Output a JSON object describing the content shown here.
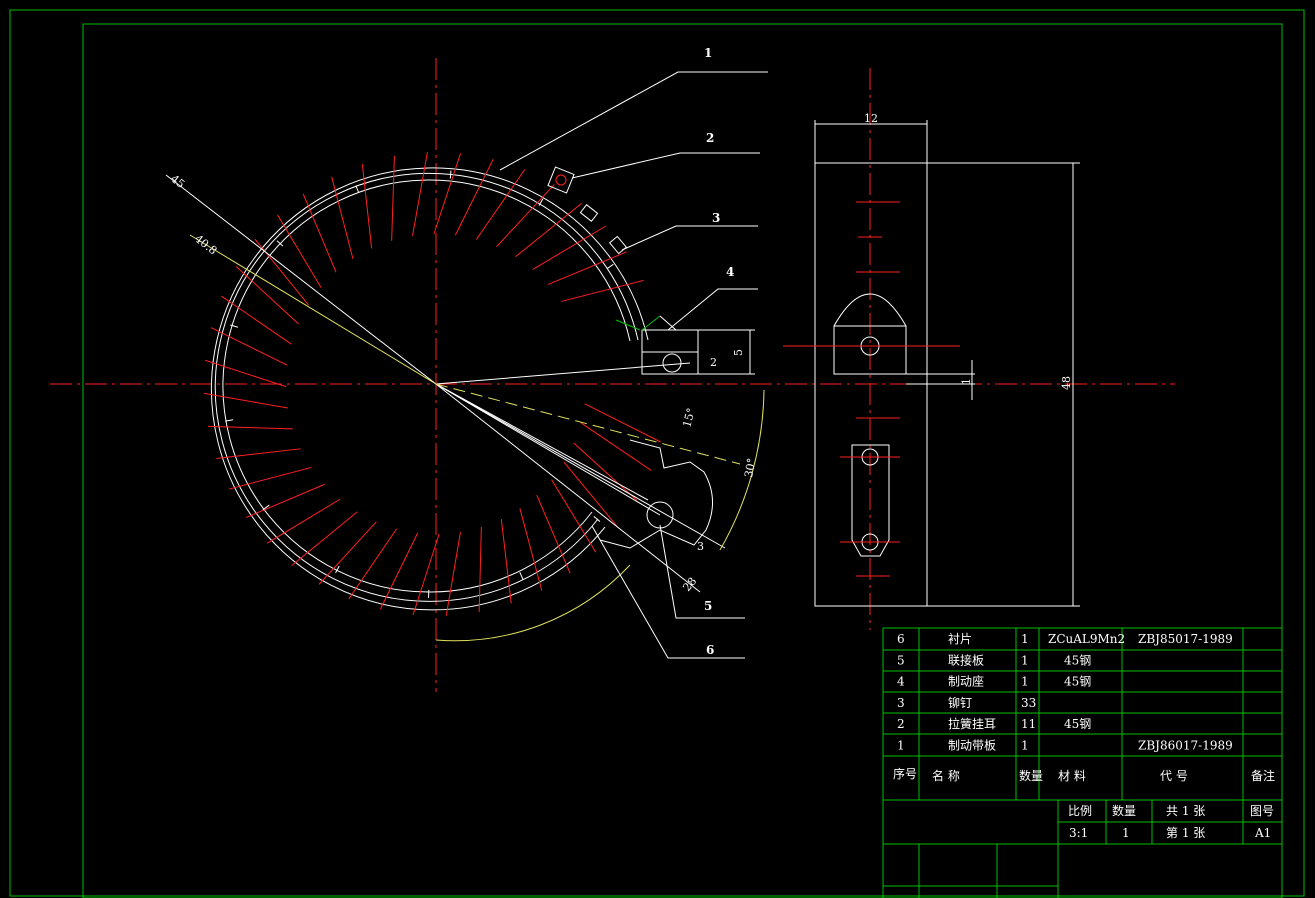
{
  "drawing": {
    "callouts": [
      "1",
      "2",
      "3",
      "4",
      "5",
      "6"
    ],
    "dims": {
      "r45": "45",
      "r40_8": "40.8",
      "angle15": "15°",
      "angle30": "30°",
      "w12": "12",
      "h48": "48",
      "h5": "5",
      "d2": "2",
      "d1": "1",
      "d3": "3",
      "d28": "28"
    }
  },
  "bom": {
    "rows": [
      {
        "no": "6",
        "name": "衬片",
        "qty": "1",
        "material": "ZCuAL9Mn2",
        "code": "ZBJ85017-1989",
        "note": ""
      },
      {
        "no": "5",
        "name": "联接板",
        "qty": "1",
        "material": "45钢",
        "code": "",
        "note": ""
      },
      {
        "no": "4",
        "name": "制动座",
        "qty": "1",
        "material": "45钢",
        "code": "",
        "note": ""
      },
      {
        "no": "3",
        "name": "铆钉",
        "qty": "33",
        "material": "",
        "code": "",
        "note": ""
      },
      {
        "no": "2",
        "name": "拉簧挂耳",
        "qty": "11",
        "material": "45钢",
        "code": "",
        "note": ""
      },
      {
        "no": "1",
        "name": "制动带板",
        "qty": "1",
        "material": "",
        "code": "ZBJ86017-1989",
        "note": ""
      }
    ],
    "header": {
      "no": "序号",
      "name": "名 称",
      "qty": "数量",
      "material": "材 料",
      "code": "代 号",
      "note": "备注"
    }
  },
  "titleblock": {
    "scale_label": "比例",
    "qty_label": "数量",
    "sheets_total": "共 1 张",
    "drawing_no_label": "图号",
    "scale": "3:1",
    "qty": "1",
    "sheet_no": "第 1 张",
    "size": "A1"
  },
  "colors": {
    "border": "#00c000",
    "line": "#ffffff",
    "center": "#ff2020",
    "dim_yellow": "#e0e060",
    "background": "#000000"
  }
}
